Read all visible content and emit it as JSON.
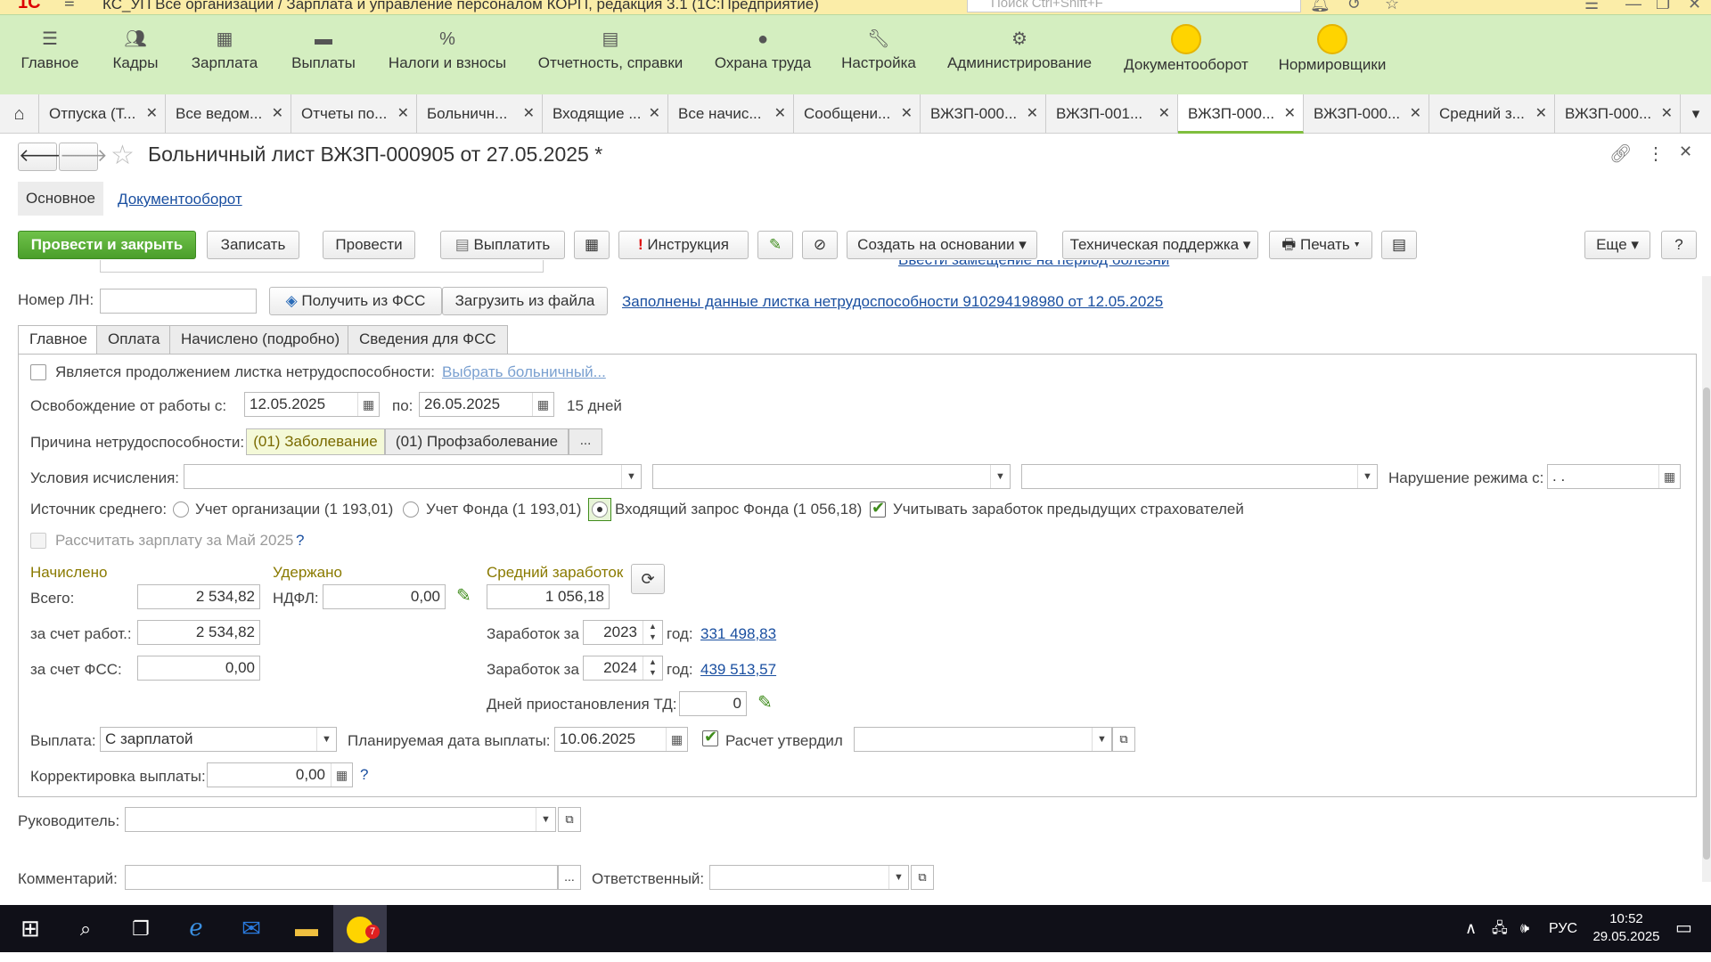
{
  "titlebar": {
    "app_title": "КС_УП Все организации / Зарплата и управление персоналом КОРП, редакция 3.1  (1С:Предприятие)",
    "search_placeholder": "Поиск Ctrl+Shift+F",
    "logo": "1С"
  },
  "sections": [
    {
      "label": "Главное",
      "icon": "menu-icon"
    },
    {
      "label": "Кадры",
      "icon": "people-icon"
    },
    {
      "label": "Зарплата",
      "icon": "calculator-icon"
    },
    {
      "label": "Выплаты",
      "icon": "card-icon"
    },
    {
      "label": "Налоги и взносы",
      "icon": "percent-icon"
    },
    {
      "label": "Отчетность, справки",
      "icon": "report-icon"
    },
    {
      "label": "Охрана труда",
      "icon": "helmet-icon"
    },
    {
      "label": "Настройка",
      "icon": "wrench-icon"
    },
    {
      "label": "Администрирование",
      "icon": "gear-icon"
    },
    {
      "label": "Документооборот",
      "icon": "sun-icon"
    },
    {
      "label": "Нормировщики",
      "icon": "sun-icon"
    }
  ],
  "tabs": [
    {
      "label": "Отпуска (Т..."
    },
    {
      "label": "Все ведом..."
    },
    {
      "label": "Отчеты по..."
    },
    {
      "label": "Больничн..."
    },
    {
      "label": "Входящие ..."
    },
    {
      "label": "Все начис..."
    },
    {
      "label": "Сообщени..."
    },
    {
      "label": "ВЖЗП-000..."
    },
    {
      "label": "ВЖЗП-001..."
    },
    {
      "label": "ВЖЗП-000...",
      "active": true
    },
    {
      "label": "ВЖЗП-000..."
    },
    {
      "label": "Средний з..."
    },
    {
      "label": "ВЖЗП-000..."
    }
  ],
  "form": {
    "title": "Больничный лист ВЖЗП-000905 от 27.05.2025 *",
    "subnav": {
      "main": "Основное",
      "docflow": "Документооборот"
    },
    "toolbar": {
      "post_close": "Провести и закрыть",
      "save": "Записать",
      "post": "Провести",
      "pay": "Выплатить",
      "instruction": "Инструкция",
      "create_based": "Создать на основании",
      "support": "Техническая поддержка",
      "print": "Печать",
      "more": "Еще",
      "help": "?"
    },
    "cut_link": "Ввести замещение на период болезни",
    "ln": {
      "label": "Номер ЛН:",
      "value": "",
      "get_fss": "Получить из ФСС",
      "load_file": "Загрузить из файла",
      "filled_link": "Заполнены данные листка нетрудоспособности 910294198980 от 12.05.2025"
    },
    "inner_tabs": [
      "Главное",
      "Оплата",
      "Начислено (подробно)",
      "Сведения для ФСС"
    ],
    "continuation_label": "Является продолжением листка нетрудоспособности:",
    "choose_sick": "Выбрать больничный...",
    "release_label": "Освобождение от работы с:",
    "date_from": "12.05.2025",
    "to_label": "по:",
    "date_to": "26.05.2025",
    "days": "15 дней",
    "reason_label": "Причина нетрудоспособности:",
    "reason_1": "(01) Заболевание",
    "reason_2": "(01) Профзаболевание",
    "reason_more": "...",
    "conditions_label": "Условия исчисления:",
    "violation_label": "Нарушение режима с:",
    "violation_value": " .  .",
    "avg_source_label": "Источник среднего:",
    "radio_org": "Учет организации (1 193,01)",
    "radio_fund": "Учет Фонда (1 193,01)",
    "radio_incoming": "Входящий запрос Фонда (1 056,18)",
    "prev_insurers": "Учитывать заработок предыдущих страхователей",
    "calc_salary": "Рассчитать зарплату за Май 2025",
    "accrued": {
      "header": "Начислено",
      "total_label": "Всего:",
      "total": "2 534,82",
      "employer_label": "за счет работ.:",
      "employer": "2 534,82",
      "fss_label": "за счет ФСС:",
      "fss": "0,00"
    },
    "withheld": {
      "header": "Удержано",
      "ndfl_label": "НДФЛ:",
      "ndfl": "0,00"
    },
    "avg": {
      "header": "Средний заработок",
      "value": "1 056,18",
      "earn_label": "Заработок за",
      "year1": "2023",
      "year_label": "год:",
      "amount1": "331 498,83",
      "year2": "2024",
      "amount2": "439 513,57",
      "suspension_label": "Дней приостановления ТД:",
      "suspension": "0"
    },
    "payment": {
      "label": "Выплата:",
      "value": "С зарплатой",
      "planned_label": "Планируемая дата выплаты:",
      "planned": "10.06.2025",
      "approved_label": "Расчет утвердил",
      "approved_value": "",
      "adjust_label": "Корректировка выплаты:",
      "adjust": "0,00"
    },
    "manager_label": "Руководитель:",
    "comment_label": "Комментарий:",
    "responsible_label": "Ответственный:"
  },
  "taskbar": {
    "lang": "РУС",
    "time": "10:52",
    "date": "29.05.2025",
    "badge": "7"
  },
  "colors": {
    "accent_green": "#4a9e2a",
    "section_bg": "#d4eec0",
    "link": "#1a4fa0"
  }
}
